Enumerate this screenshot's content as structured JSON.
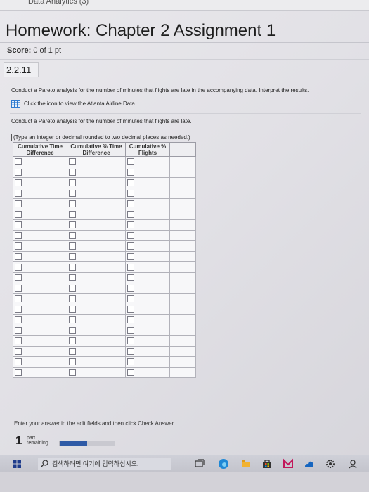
{
  "browser": {
    "tab_fragment": "Data Analytics (3)"
  },
  "homework": {
    "title": "Homework: Chapter 2 Assignment 1",
    "score_label": "Score:",
    "score_value": "0 of 1 pt"
  },
  "question": {
    "number": "2.2.11",
    "prompt": "Conduct a Pareto analysis for the number of minutes that flights are late in the accompanying data. Interpret the results.",
    "data_link": "Click the icon to view the Atlanta Airline Data.",
    "sub_prompt": "Conduct a Pareto analysis for the number of minutes that flights are late.",
    "instruction": "(Type an integer or decimal rounded to two decimal places as needed.)"
  },
  "table": {
    "headers": [
      [
        "Cumulative Time",
        "Difference"
      ],
      [
        "Cumulative % Time",
        "Difference"
      ],
      [
        "Cumulative %",
        "Flights"
      ]
    ],
    "row_count": 21
  },
  "footer": {
    "enter_note": "Enter your answer in the edit fields and then click Check Answer.",
    "parts_remaining": "1",
    "parts_label": "part remaining",
    "progress_fraction": 0.5
  },
  "taskbar": {
    "search_placeholder": "검색하려면 여기에 입력하십시오.",
    "icons": [
      "windows-icon",
      "search-icon",
      "task-view-icon",
      "edge-icon",
      "file-explorer-icon",
      "store-icon",
      "mail-icon",
      "onedrive-icon",
      "settings-icon",
      "user-icon"
    ]
  },
  "colors": {
    "progress": "#2e5aa6",
    "windows": "#1e3c8c",
    "edge": "#1e88d6",
    "mail": "#c2185b",
    "explorer": "#f2b230"
  }
}
